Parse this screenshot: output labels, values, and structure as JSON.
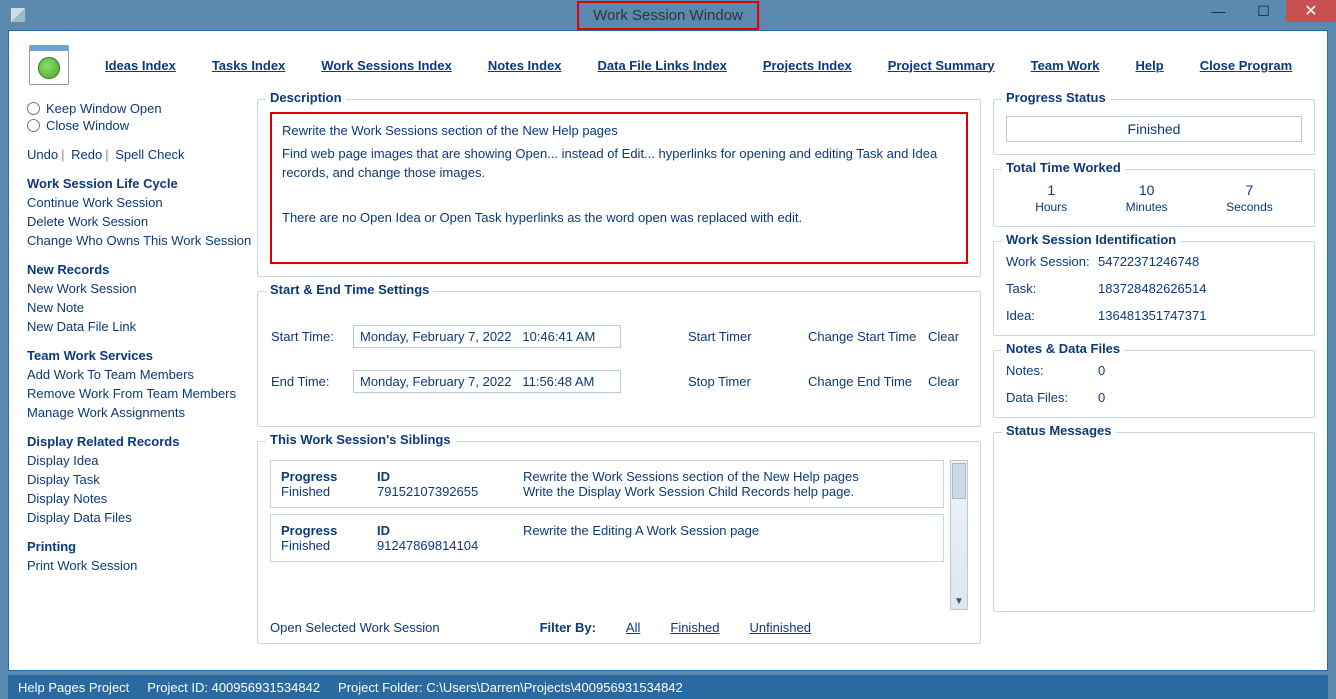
{
  "window": {
    "title": "Work Session Window"
  },
  "menu": {
    "ideas": "Ideas Index",
    "tasks": "Tasks Index",
    "work_sessions": "Work Sessions Index",
    "notes": "Notes Index",
    "data_file_links": "Data File Links Index",
    "projects": "Projects Index",
    "project_summary": "Project Summary",
    "team_work": "Team Work",
    "help": "Help",
    "close_program": "Close Program"
  },
  "left": {
    "keep_open": "Keep Window Open",
    "close_window": "Close Window",
    "undo": "Undo",
    "redo": "Redo",
    "spell": "Spell Check",
    "life_cycle_hdr": "Work Session Life Cycle",
    "continue": "Continue Work Session",
    "delete": "Delete Work Session",
    "change_owner": "Change Who Owns This Work Session",
    "new_records_hdr": "New Records",
    "new_ws": "New Work Session",
    "new_note": "New Note",
    "new_dfl": "New Data File Link",
    "team_hdr": "Team Work Services",
    "add_team": "Add Work To Team Members",
    "remove_team": "Remove Work From Team Members",
    "manage_team": "Manage Work Assignments",
    "display_hdr": "Display Related Records",
    "disp_idea": "Display Idea",
    "disp_task": "Display Task",
    "disp_notes": "Display Notes",
    "disp_files": "Display Data Files",
    "print_hdr": "Printing",
    "print_ws": "Print Work Session"
  },
  "description": {
    "legend": "Description",
    "line1": "Rewrite the Work Sessions section of the New Help pages",
    "line2": "Find web page images that are showing Open... instead of Edit... hyperlinks for opening and editing Task and Idea records, and change those images.",
    "line3": "There are no Open Idea or Open Task hyperlinks as the word open was replaced with edit."
  },
  "times": {
    "legend": "Start & End Time Settings",
    "start_label": "Start Time:",
    "start_value": "Monday, February 7, 2022   10:46:41 AM",
    "end_label": "End Time:",
    "end_value": "Monday, February 7, 2022   11:56:48 AM",
    "start_timer": "Start Timer",
    "change_start": "Change Start Time",
    "stop_timer": "Stop Timer",
    "change_end": "Change End Time",
    "clear": "Clear"
  },
  "siblings": {
    "legend": "This Work Session's Siblings",
    "col_progress": "Progress",
    "col_id": "ID",
    "items": [
      {
        "progress": "Finished",
        "id": "79152107392655",
        "text1": "Rewrite the Work Sessions section of the New Help pages",
        "text2": "Write the Display Work Session Child Records help page."
      },
      {
        "progress": "Finished",
        "id": "91247869814104",
        "text1": "Rewrite the Editing A Work Session page",
        "text2": ""
      }
    ],
    "open_selected": "Open Selected Work Session",
    "filter_by": "Filter By:",
    "filter_all": "All",
    "filter_finished": "Finished",
    "filter_unfinished": "Unfinished"
  },
  "right": {
    "progress_legend": "Progress Status",
    "progress_value": "Finished",
    "ttw_legend": "Total Time Worked",
    "hours_v": "1",
    "hours_u": "Hours",
    "minutes_v": "10",
    "minutes_u": "Minutes",
    "seconds_v": "7",
    "seconds_u": "Seconds",
    "ident_legend": "Work Session Identification",
    "ws_label": "Work Session:",
    "ws_value": "54722371246748",
    "task_label": "Task:",
    "task_value": "183728482626514",
    "idea_label": "Idea:",
    "idea_value": "136481351747371",
    "notes_legend": "Notes & Data Files",
    "notes_label": "Notes:",
    "notes_value": "0",
    "files_label": "Data Files:",
    "files_value": "0",
    "status_legend": "Status Messages"
  },
  "statusbar": {
    "project_name": "Help Pages Project",
    "project_id_label": "Project ID:",
    "project_id": "400956931534842",
    "folder_label": "Project Folder:",
    "folder": "C:\\Users\\Darren\\Projects\\400956931534842"
  }
}
